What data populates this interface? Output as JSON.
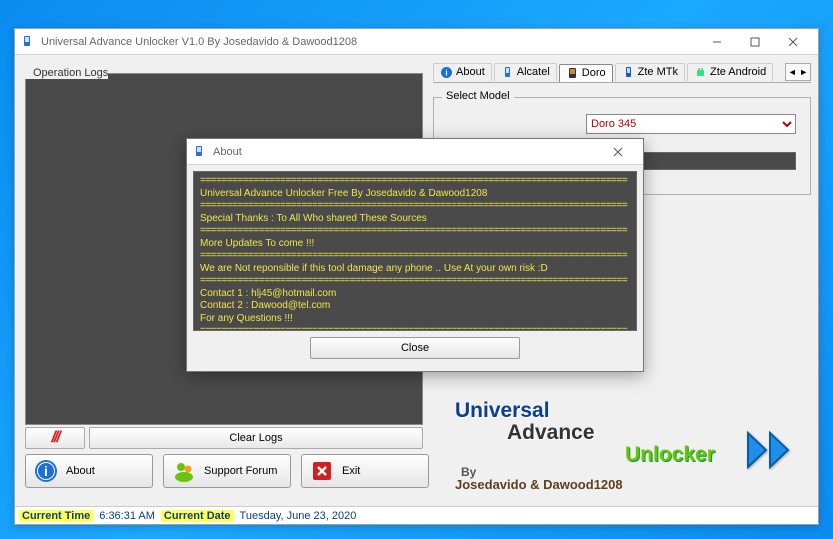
{
  "window": {
    "title": "Universal Advance Unlocker V1.0 By Josedavido & Dawood1208"
  },
  "logs": {
    "label": "Operation Logs",
    "clear": "Clear Logs"
  },
  "tabs": {
    "items": [
      "About",
      "Alcatel",
      "Doro",
      "Zte MTk",
      "Zte Android"
    ],
    "active": 2
  },
  "model": {
    "label": "Select Model",
    "selected": "Doro 345"
  },
  "buttons": {
    "about": "About",
    "support": "Support Forum",
    "exit": "Exit"
  },
  "branding": {
    "l1": "Universal",
    "l2": "Advance",
    "l3": "Unlocker",
    "by": "By",
    "names": "Josedavido & Dawood1208"
  },
  "status": {
    "time_label": "Current Time",
    "time": "6:36:31 AM",
    "date_label": "Current Date",
    "date": "Tuesday, June 23, 2020"
  },
  "about": {
    "title": "About",
    "sep": "================================================================================",
    "lines": {
      "a": "Universal Advance Unlocker Free By Josedavido & Dawood1208",
      "b": "Special Thanks : To All Who shared These Sources",
      "c": "More Updates To come !!!",
      "d": "We are Not reponsible if this tool damage any phone .. Use At your own risk :D",
      "e": "Contact 1 : hlj45@hotmail.com",
      "f": "Contact 2 : Dawood@tel.com",
      "g": "For any Questions !!!"
    },
    "close": "Close"
  }
}
